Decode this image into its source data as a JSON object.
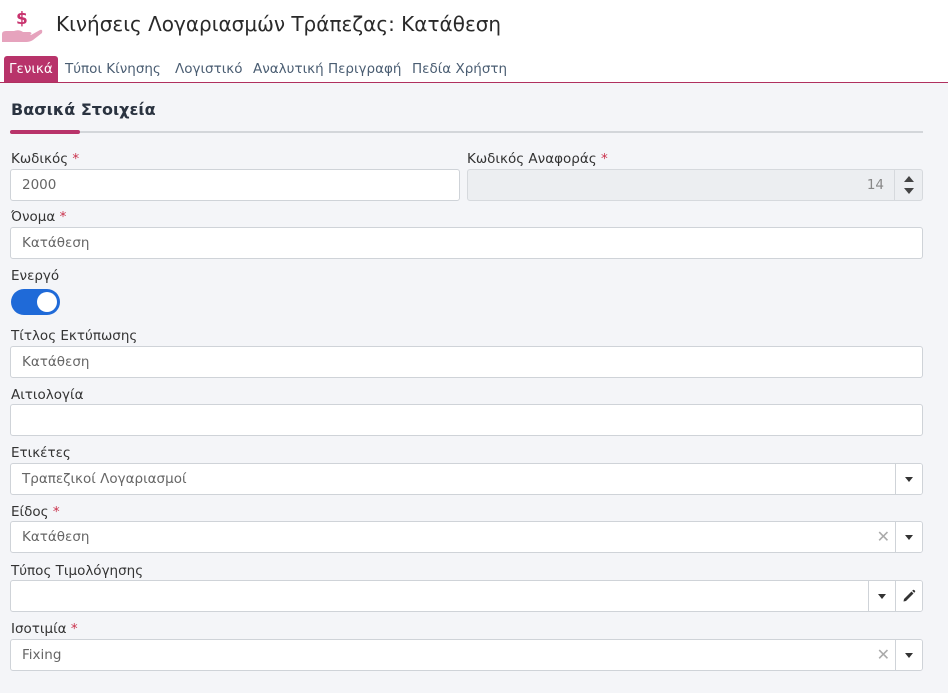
{
  "header": {
    "title": "Κινήσεις Λογαριασμών Τράπεζας: Κατάθεση",
    "icon": "money-hand-icon",
    "icon_color": "#c8336e"
  },
  "tabs": [
    {
      "label": "Γενικά",
      "active": true
    },
    {
      "label": "Τύποι Κίνησης",
      "active": false
    },
    {
      "label": "Λογιστικό",
      "active": false
    },
    {
      "label": "Αναλυτική Περιγραφή",
      "active": false
    },
    {
      "label": "Πεδία Χρήστη",
      "active": false
    }
  ],
  "section": {
    "title": "Βασικά Στοιχεία"
  },
  "form": {
    "code": {
      "label": "Κωδικός",
      "required": "*",
      "value": "2000"
    },
    "ref_code": {
      "label": "Κωδικός Αναφοράς",
      "required": "*",
      "value": "14"
    },
    "name": {
      "label": "Όνομα",
      "required": "*",
      "value": "Κατάθεση"
    },
    "active": {
      "label": "Ενεργό",
      "value": true
    },
    "print_title": {
      "label": "Τίτλος Εκτύπωσης",
      "value": "Κατάθεση"
    },
    "reason": {
      "label": "Αιτιολογία",
      "value": ""
    },
    "tags": {
      "label": "Ετικέτες",
      "value": "Τραπεζικοί Λογαριασμοί"
    },
    "kind": {
      "label": "Είδος",
      "required": "*",
      "value": "Κατάθεση"
    },
    "pricing_type": {
      "label": "Τύπος Τιμολόγησης",
      "value": ""
    },
    "parity": {
      "label": "Ισοτιμία",
      "required": "*",
      "value": "Fixing"
    }
  },
  "colors": {
    "accent": "#b8336a",
    "toggle": "#1f6ad8"
  }
}
